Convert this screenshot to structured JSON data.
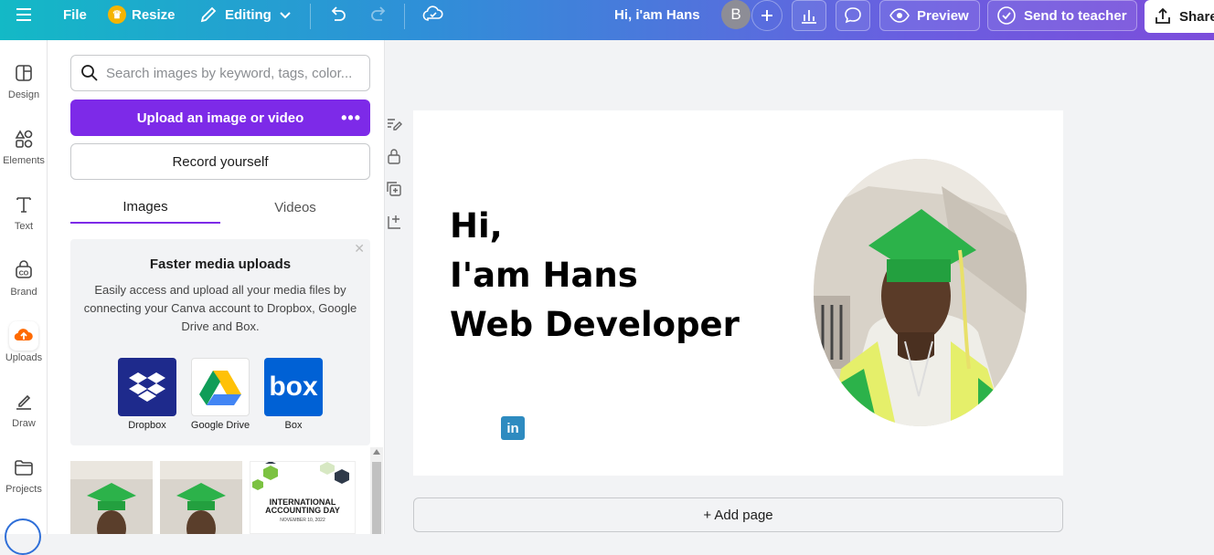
{
  "topbar": {
    "file": "File",
    "resize": "Resize",
    "editing": "Editing",
    "doc_title": "Hi, i'am Hans",
    "avatar_initial": "B",
    "preview": "Preview",
    "send_to_teacher": "Send to teacher",
    "share": "Share"
  },
  "rail": [
    {
      "label": "Design",
      "icon": "design-icon"
    },
    {
      "label": "Elements",
      "icon": "elements-icon"
    },
    {
      "label": "Text",
      "icon": "text-icon"
    },
    {
      "label": "Brand",
      "icon": "brand-icon"
    },
    {
      "label": "Uploads",
      "icon": "uploads-icon"
    },
    {
      "label": "Draw",
      "icon": "draw-icon"
    },
    {
      "label": "Projects",
      "icon": "projects-icon"
    }
  ],
  "panel": {
    "search_placeholder": "Search images by keyword, tags, color...",
    "upload_label": "Upload an image or video",
    "record_label": "Record yourself",
    "tabs": [
      "Images",
      "Videos"
    ],
    "promo_title": "Faster media uploads",
    "promo_text": "Easily access and upload all your media files by connecting your Canva account to Dropbox, Google Drive and Box.",
    "services": [
      "Dropbox",
      "Google Drive",
      "Box"
    ],
    "thumb_text_1": "INTERNATIONAL ACCOUNTING DAY",
    "thumb_text_2": "NOVEMBER 10, 2022"
  },
  "canvas": {
    "line1": "Hi,",
    "line2": "I'am Hans",
    "line3": "Web Developer",
    "linkedin": "in",
    "add_page": "+ Add page"
  },
  "colors": {
    "accent": "#7d2ae8",
    "topbar_start": "#13b9c6",
    "topbar_end": "#7c4ddb",
    "dropbox": "#1e2a8c",
    "box": "#0061d5",
    "linkedin": "#2e8bc0"
  }
}
